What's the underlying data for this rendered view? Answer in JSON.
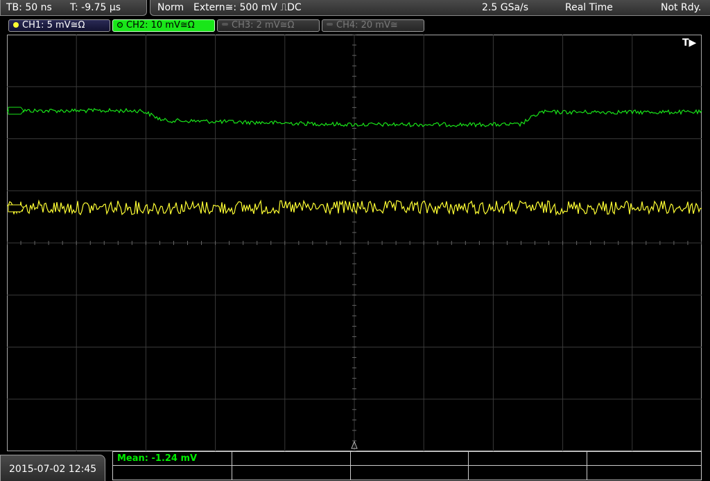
{
  "status": {
    "timebase": "TB: 50 ns",
    "trigger_pos": "T: -9.75 µs",
    "mode": "Norm",
    "trigger_source": "Extern≅: 500 mV ⎍DC",
    "sample_rate": "2.5 GSa/s",
    "acq_mode": "Real Time",
    "ready_state": "Not Rdy."
  },
  "channels": [
    {
      "label": "CH1: 5 mV≅Ω",
      "color": "#ffff33",
      "active": true
    },
    {
      "label": "CH2: 10 mV≅Ω",
      "color": "#19e619",
      "active": true
    },
    {
      "label": "CH3: 2 mV≅Ω",
      "color": "#7a7a7a",
      "active": false
    },
    {
      "label": "CH4: 20 mV≅",
      "color": "#7a7a7a",
      "active": false
    }
  ],
  "trigger_marker": "T▶",
  "datetime": "2015-07-02 12:45",
  "measurement": {
    "mean": "Mean: -1.24 mV"
  }
}
